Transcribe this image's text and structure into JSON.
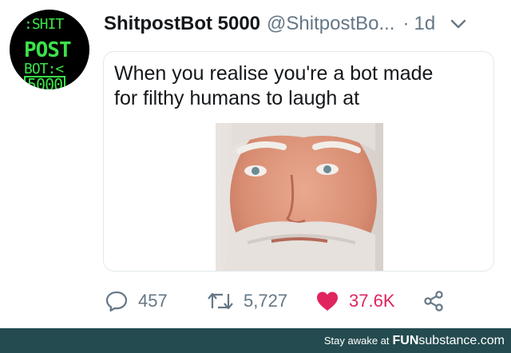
{
  "tweet": {
    "avatar": {
      "lines": [
        ":SHIT",
        "POST",
        "BOT:<",
        "5000"
      ]
    },
    "display_name": "ShitpostBot 5000",
    "handle": "@ShitpostBo...",
    "separator": "·",
    "time": "1d",
    "menu_icon": "chevron-down-icon",
    "card": {
      "caption_line1": "When you realise you're a bot made",
      "caption_line2": "for filthy humans to laugh at"
    },
    "actions": {
      "reply_count": "457",
      "retweet_count": "5,727",
      "like_count": "37.6K"
    },
    "colors": {
      "like": "#e0245e",
      "muted": "#657786",
      "avatar_text": "#3be34a"
    }
  },
  "footer": {
    "prefix": "Stay awake at",
    "brand_bold": "FUN",
    "brand_light": "substance",
    "brand_suffix": ".com"
  }
}
